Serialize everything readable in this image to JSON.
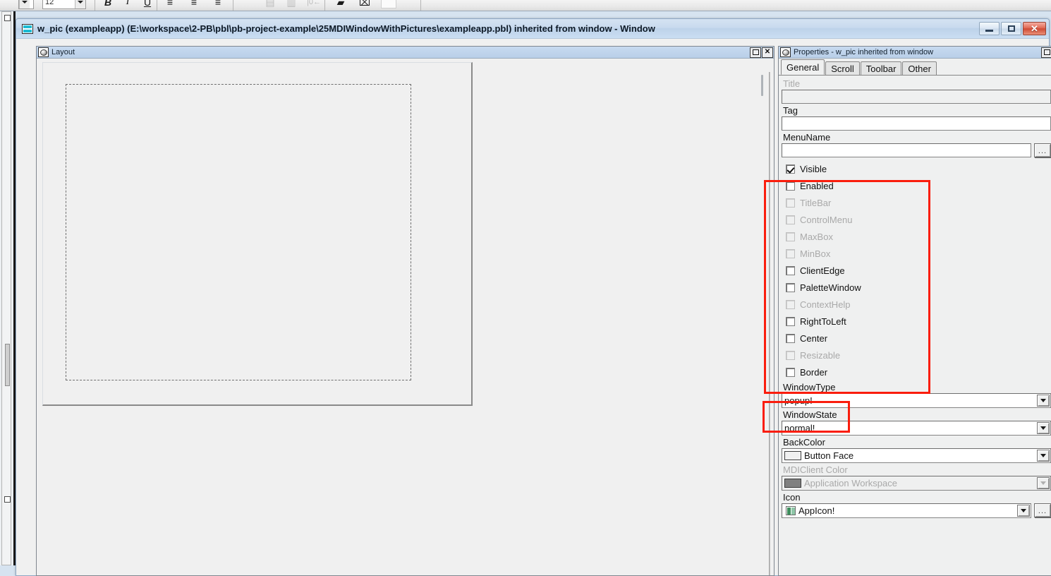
{
  "toolbar": {
    "font_size_value": "12",
    "buttons": [
      {
        "name": "bold-button",
        "glyph": "B",
        "dim": false
      },
      {
        "name": "italic-button",
        "glyph": "I",
        "dim": false
      },
      {
        "name": "underline-button",
        "glyph": "U",
        "dim": false
      },
      {
        "name": "align-left-button",
        "glyph": "≡",
        "dim": false
      },
      {
        "name": "align-center-button",
        "glyph": "≡",
        "dim": false
      },
      {
        "name": "align-right-button",
        "glyph": "≡",
        "dim": false
      },
      {
        "name": "tab-order-button",
        "glyph": "▤",
        "dim": true
      },
      {
        "name": "grid-button",
        "glyph": "▦",
        "dim": true
      },
      {
        "name": "indent-button",
        "glyph": "|⇤",
        "dim": true
      },
      {
        "name": "preview-button",
        "glyph": "▰",
        "dim": false
      },
      {
        "name": "script-button",
        "glyph": "⌘",
        "dim": false
      }
    ]
  },
  "window": {
    "title": "w_pic (exampleapp) (E:\\workspace\\2-PB\\pbl\\pb-project-example\\25MDIWindowWithPictures\\exampleapp.pbl) inherited from window - Window",
    "icon_name": "window-painter-icon",
    "minimize_label": "Minimize",
    "maximize_label": "Restore",
    "close_label": "Close"
  },
  "layout_pane": {
    "title": "Layout",
    "restore_label": "□",
    "close_label": "✕"
  },
  "properties_pane": {
    "title": "Properties - w_pic inherited from window",
    "restore_label": "□",
    "close_label": "✕",
    "tabs": [
      {
        "label": "General",
        "active": true
      },
      {
        "label": "Scroll",
        "active": false
      },
      {
        "label": "Toolbar",
        "active": false
      },
      {
        "label": "Other",
        "active": false
      }
    ],
    "fields": {
      "title": {
        "label": "Title",
        "value": "",
        "disabled": true
      },
      "tag": {
        "label": "Tag",
        "value": "",
        "disabled": false
      },
      "menuname": {
        "label": "MenuName",
        "value": "",
        "disabled": false,
        "browse_label": "..."
      }
    },
    "checkboxes": [
      {
        "label": "Visible",
        "checked": true,
        "disabled": false
      },
      {
        "label": "Enabled",
        "checked": false,
        "disabled": false
      },
      {
        "label": "TitleBar",
        "checked": false,
        "disabled": true
      },
      {
        "label": "ControlMenu",
        "checked": false,
        "disabled": true
      },
      {
        "label": "MaxBox",
        "checked": false,
        "disabled": true
      },
      {
        "label": "MinBox",
        "checked": false,
        "disabled": true
      },
      {
        "label": "ClientEdge",
        "checked": false,
        "disabled": false
      },
      {
        "label": "PaletteWindow",
        "checked": false,
        "disabled": false
      },
      {
        "label": "ContextHelp",
        "checked": false,
        "disabled": true
      },
      {
        "label": "RightToLeft",
        "checked": false,
        "disabled": false
      },
      {
        "label": "Center",
        "checked": false,
        "disabled": false
      },
      {
        "label": "Resizable",
        "checked": false,
        "disabled": true
      },
      {
        "label": "Border",
        "checked": false,
        "disabled": false
      }
    ],
    "dropdowns": [
      {
        "name": "windowtype",
        "label": "WindowType",
        "value": "popup!",
        "disabled": false,
        "swatch": null,
        "icon": false,
        "browse": false
      },
      {
        "name": "windowstate",
        "label": "WindowState",
        "value": "normal!",
        "disabled": false,
        "swatch": null,
        "icon": false,
        "browse": false
      },
      {
        "name": "backcolor",
        "label": "BackColor",
        "value": "Button Face",
        "disabled": false,
        "swatch": "#f0f0f0",
        "icon": false,
        "browse": false
      },
      {
        "name": "mdiclient-color",
        "label": "MDIClient Color",
        "value": "Application Workspace",
        "disabled": true,
        "swatch": "#808080",
        "icon": false,
        "browse": false
      },
      {
        "name": "icon",
        "label": "Icon",
        "value": "AppIcon!",
        "disabled": false,
        "swatch": null,
        "icon": true,
        "browse": true,
        "browse_label": "..."
      }
    ]
  },
  "annotations": {
    "highlight_color": "#fa1d0d",
    "boxes": [
      {
        "name": "checkbox-group-highlight"
      },
      {
        "name": "windowtype-highlight"
      }
    ]
  }
}
